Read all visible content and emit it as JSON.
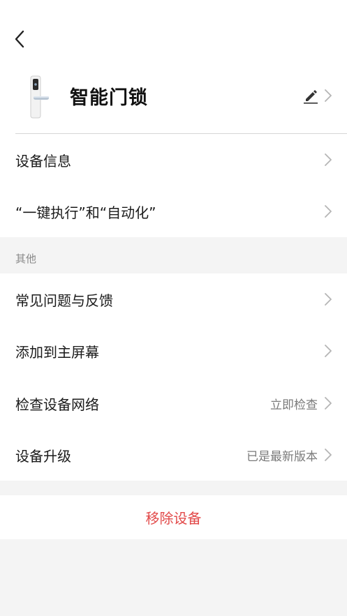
{
  "header": {
    "back_icon": "chevron-left-icon"
  },
  "device": {
    "name": "智能门锁",
    "image": "door-lock",
    "edit_icon": "pencil-icon"
  },
  "main_list": [
    {
      "label": "设备信息"
    },
    {
      "label": "“一键执行”和“自动化”"
    }
  ],
  "other_section": {
    "title": "其他",
    "items": [
      {
        "label": "常见问题与反馈",
        "value": ""
      },
      {
        "label": "添加到主屏幕",
        "value": ""
      },
      {
        "label": "检查设备网络",
        "value": "立即检查"
      },
      {
        "label": "设备升级",
        "value": "已是最新版本"
      }
    ]
  },
  "remove": {
    "label": "移除设备",
    "color": "#e24a4a"
  }
}
